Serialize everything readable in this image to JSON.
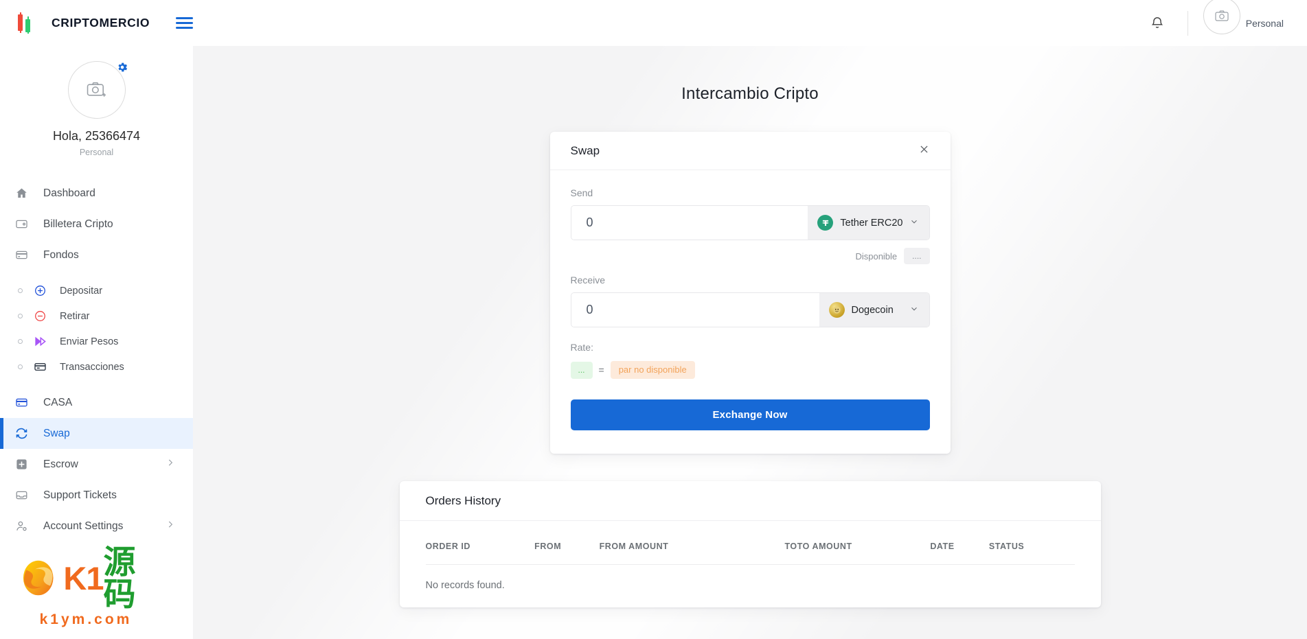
{
  "brand": {
    "name": "CRIPTOMERCIO",
    "logo_icon": "candlestick-logo-icon",
    "menu_icon": "hamburger-menu-icon"
  },
  "topbar": {
    "notification_icon": "bell-icon",
    "avatar_icon": "camera-avatar-icon",
    "username": "Personal"
  },
  "profile": {
    "avatar_icon": "camera-placeholder-icon",
    "settings_icon": "gear-icon",
    "greeting": "Hola, 25366474",
    "account_type": "Personal"
  },
  "sidebar": {
    "items": [
      {
        "label": "Dashboard",
        "icon": "home-icon",
        "type": "item",
        "active": false
      },
      {
        "label": "Billetera Cripto",
        "icon": "wallet-icon",
        "type": "item",
        "active": false
      },
      {
        "label": "Fondos",
        "icon": "card-icon",
        "type": "item",
        "active": false
      },
      {
        "label": "Depositar",
        "icon": "plus-circle-icon",
        "type": "sub",
        "active": false
      },
      {
        "label": "Retirar",
        "icon": "minus-circle-icon",
        "type": "sub",
        "active": false
      },
      {
        "label": "Enviar Pesos",
        "icon": "fast-forward-icon",
        "type": "sub",
        "active": false
      },
      {
        "label": "Transacciones",
        "icon": "transactions-card-icon",
        "type": "sub",
        "active": false
      },
      {
        "label": "CASA",
        "icon": "casa-card-icon",
        "type": "item",
        "active": false
      },
      {
        "label": "Swap",
        "icon": "swap-refresh-icon",
        "type": "item",
        "active": true
      },
      {
        "label": "Escrow",
        "icon": "escrow-plus-icon",
        "type": "item",
        "active": false,
        "chevron": "chevron-right-icon"
      },
      {
        "label": "Support Tickets",
        "icon": "inbox-icon",
        "type": "item",
        "active": false
      },
      {
        "label": "Account Settings",
        "icon": "user-settings-icon",
        "type": "item",
        "active": false,
        "chevron": "chevron-right-icon"
      }
    ]
  },
  "watermark": {
    "text_latin": "K1",
    "text_cn": "源码",
    "url": "k1ym.com"
  },
  "page": {
    "title": "Intercambio Cripto"
  },
  "swap": {
    "title": "Swap",
    "close_icon": "close-icon",
    "send": {
      "label": "Send",
      "amount": "0",
      "placeholder": "0",
      "coin": "Tether ERC20",
      "coin_icon": "tether-icon",
      "coin_color": "#26a17b",
      "chevron": "chevron-down-icon"
    },
    "available": {
      "label": "Disponible",
      "value": "...."
    },
    "receive": {
      "label": "Receive",
      "amount": "0",
      "placeholder": "0",
      "coin": "Dogecoin",
      "coin_icon": "dogecoin-icon",
      "coin_color": "#c2a633",
      "chevron": "chevron-down-icon"
    },
    "rate": {
      "label": "Rate:",
      "from_value": "...",
      "equals": "=",
      "to_value": "par no disponible"
    },
    "submit_label": "Exchange Now",
    "accent_color": "#1769d6"
  },
  "orders": {
    "title": "Orders History",
    "columns": [
      "ORDER ID",
      "FROM",
      "FROM AMOUNT",
      "TO",
      "TO AMOUNT",
      "DATE",
      "STATUS"
    ],
    "empty_message": "No records found.",
    "rows": []
  }
}
